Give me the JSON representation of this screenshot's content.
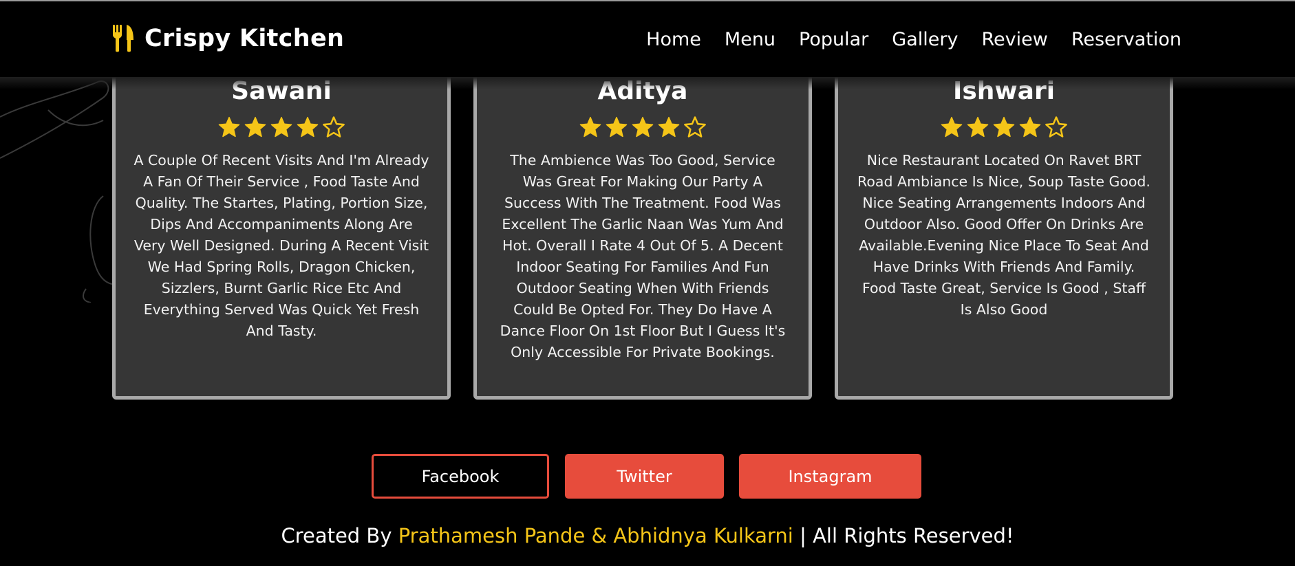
{
  "header": {
    "brand": "Crispy Kitchen",
    "nav": [
      "Home",
      "Menu",
      "Popular",
      "Gallery",
      "Review",
      "Reservation"
    ]
  },
  "reviews": [
    {
      "name": "Sawani",
      "rating": 4,
      "max_rating": 5,
      "text": "A Couple Of Recent Visits And I'm Already A Fan Of Their Service , Food Taste And Quality. The Startes, Plating, Portion Size, Dips And Accompaniments Along Are Very Well Designed. During A Recent Visit We Had Spring Rolls, Dragon Chicken, Sizzlers, Burnt Garlic Rice Etc And Everything Served Was Quick Yet Fresh And Tasty."
    },
    {
      "name": "Aditya",
      "rating": 4,
      "max_rating": 5,
      "text": "The Ambience Was Too Good, Service Was Great For Making Our Party A Success With The Treatment. Food Was Excellent The Garlic Naan Was Yum And Hot. Overall I Rate 4 Out Of 5. A Decent Indoor Seating For Families And Fun Outdoor Seating When With Friends Could Be Opted For. They Do Have A Dance Floor On 1st Floor But I Guess It's Only Accessible For Private Bookings."
    },
    {
      "name": "Ishwari",
      "rating": 4,
      "max_rating": 5,
      "text": "Nice Restaurant Located On Ravet BRT Road Ambiance Is Nice, Soup Taste Good. Nice Seating Arrangements Indoors And Outdoor Also. Good Offer On Drinks Are Available.Evening Nice Place To Seat And Have Drinks With Friends And Family. Food Taste Great, Service Is Good , Staff Is Also Good"
    }
  ],
  "social": {
    "facebook": "Facebook",
    "twitter": "Twitter",
    "instagram": "Instagram"
  },
  "footer": {
    "prefix": "Created By ",
    "authors": "Prathamesh Pande & Abhidnya Kulkarni",
    "suffix": " | All Rights Reserved!"
  },
  "colors": {
    "accent": "#f5c518",
    "button": "#e74c3c",
    "card_bg": "#363636",
    "card_border": "#a9a9a9"
  },
  "icons": {
    "logo": "utensils-icon",
    "star_filled": "star-filled-icon",
    "star_empty": "star-outline-icon"
  }
}
